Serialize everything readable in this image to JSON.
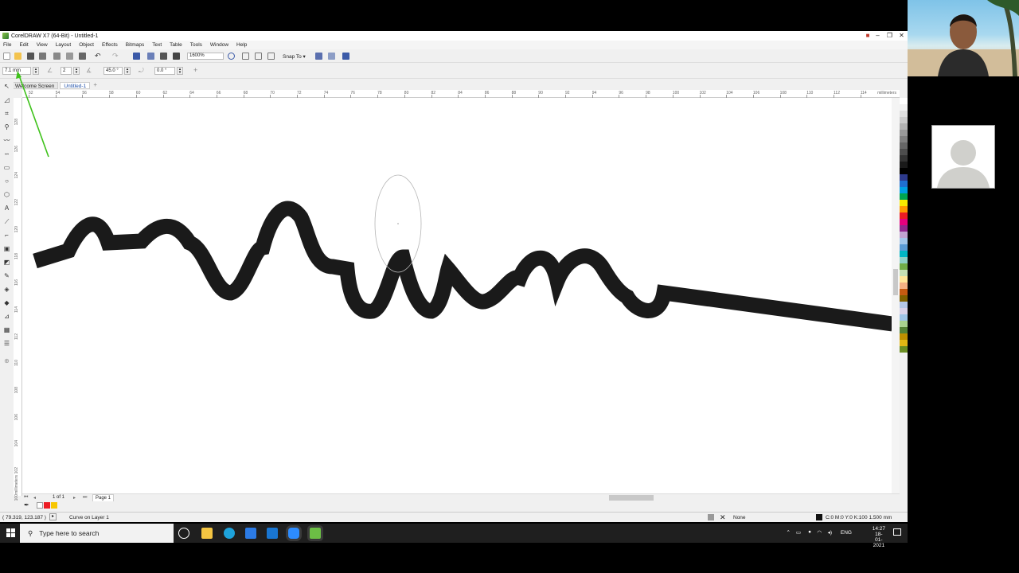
{
  "window": {
    "title": "CorelDRAW X7 (64-Bit) - Untitled-1"
  },
  "menu": [
    "File",
    "Edit",
    "View",
    "Layout",
    "Object",
    "Effects",
    "Bitmaps",
    "Text",
    "Table",
    "Tools",
    "Window",
    "Help"
  ],
  "toolbar": {
    "zoom": "1600%",
    "snap_label": "Snap To"
  },
  "property_bar": {
    "outline_width": "7.1 mm",
    "pressure": "2",
    "angle": "45.0 °",
    "rotation": "0.0 °"
  },
  "tabs": [
    "Welcome Screen",
    "Untitled-1"
  ],
  "ruler": {
    "h_labels": [
      "52",
      "54",
      "56",
      "58",
      "60",
      "62",
      "64",
      "66",
      "68",
      "70",
      "72",
      "74",
      "76",
      "78",
      "80",
      "82",
      "84",
      "86",
      "88",
      "90",
      "92",
      "94",
      "96",
      "98",
      "100",
      "102",
      "104",
      "106",
      "108",
      "110",
      "112",
      "114"
    ],
    "h_unit": "millimeters",
    "v_labels": [
      "128",
      "126",
      "124",
      "122",
      "120",
      "118",
      "116",
      "114",
      "112",
      "110",
      "108",
      "106",
      "104",
      "102",
      "100",
      "98"
    ],
    "v_unit": "millimeters"
  },
  "pagebar": {
    "page_count": "1 of 1",
    "page_tab": "Page 1"
  },
  "status": {
    "coords": "( 79.319, 123.187 )",
    "object_info": "Curve on Layer 1",
    "fill_label": "None",
    "outline_info": "C:0 M:0 Y:0 K:100  1.500 mm"
  },
  "taskbar": {
    "search_placeholder": "Type here to search",
    "lang": "ENG",
    "time": "14:27",
    "date": "18-01-2021"
  },
  "colors": {
    "accent_green": "#3ec21a",
    "stroke": "#1a1a1a",
    "taskbar": "#1f1f1f"
  },
  "palette": [
    "#ffffff",
    "#f2f2f2",
    "#e0e0e0",
    "#cccccc",
    "#b3b3b3",
    "#999999",
    "#808080",
    "#666666",
    "#4d4d4d",
    "#333333",
    "#1a1a1a",
    "#000000",
    "#2d3a8c",
    "#1f6fd1",
    "#00a0e3",
    "#00a651",
    "#f7ea00",
    "#ff9900",
    "#ed1c24",
    "#e6007e",
    "#92278f",
    "#c1a3d1",
    "#a3c6ea",
    "#5b9bd5",
    "#00b7c4",
    "#8ed1c6",
    "#70ad47",
    "#c5e0b4",
    "#ffe699",
    "#f4b183",
    "#c55a11",
    "#7f6000",
    "#b4c7e7",
    "#d9d2e9",
    "#9dc3e6",
    "#a9d18e",
    "#548235",
    "#bf9000",
    "#e2b714",
    "#6b8e23"
  ]
}
